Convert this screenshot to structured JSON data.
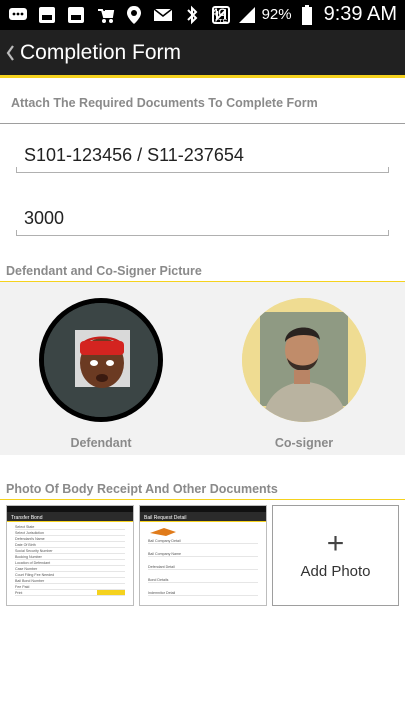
{
  "status_bar": {
    "battery_percent": "92%",
    "time": "9:39 AM",
    "network": "4G LTE",
    "icons": [
      "chat-icon",
      "gallery-icon",
      "gallery-icon",
      "stroller-icon",
      "location-icon",
      "mail-icon",
      "bluetooth-icon",
      "nfc-icon",
      "lte-icon",
      "signal-icon",
      "battery-icon"
    ]
  },
  "app_bar": {
    "title": "Completion Form"
  },
  "form": {
    "attach_header": "Attach The Required Documents To Complete Form",
    "case_number": "S101-123456 / S11-237654",
    "amount": "3000"
  },
  "pictures": {
    "header": "Defendant and Co-Signer Picture",
    "defendant_label": "Defendant",
    "cosigner_label": "Co-signer"
  },
  "documents": {
    "header": "Photo Of Body Receipt And Other Documents",
    "add_photo_label": "Add Photo",
    "thumb1": {
      "title": "Transfer Bond",
      "rows": [
        "Select State",
        "Select Jurisdiction",
        "Defendant's Name",
        "Date Of Birth",
        "Social Security Number",
        "Booking Number",
        "Location of Defendant",
        "Case Number",
        "Court Filing Fee Needed",
        "Bail Bond Number",
        "Fee Paid",
        "Print"
      ]
    },
    "thumb2": {
      "title": "Bail Request Detail",
      "rows": [
        "Bail Company Detail",
        "Bail Company Name",
        "Defendant Detail",
        "Bond Details",
        "Indemnitor Detail"
      ]
    }
  },
  "colors": {
    "accent": "#f5d21e",
    "app_bar": "#212121",
    "section_text": "#8a8a8a"
  }
}
